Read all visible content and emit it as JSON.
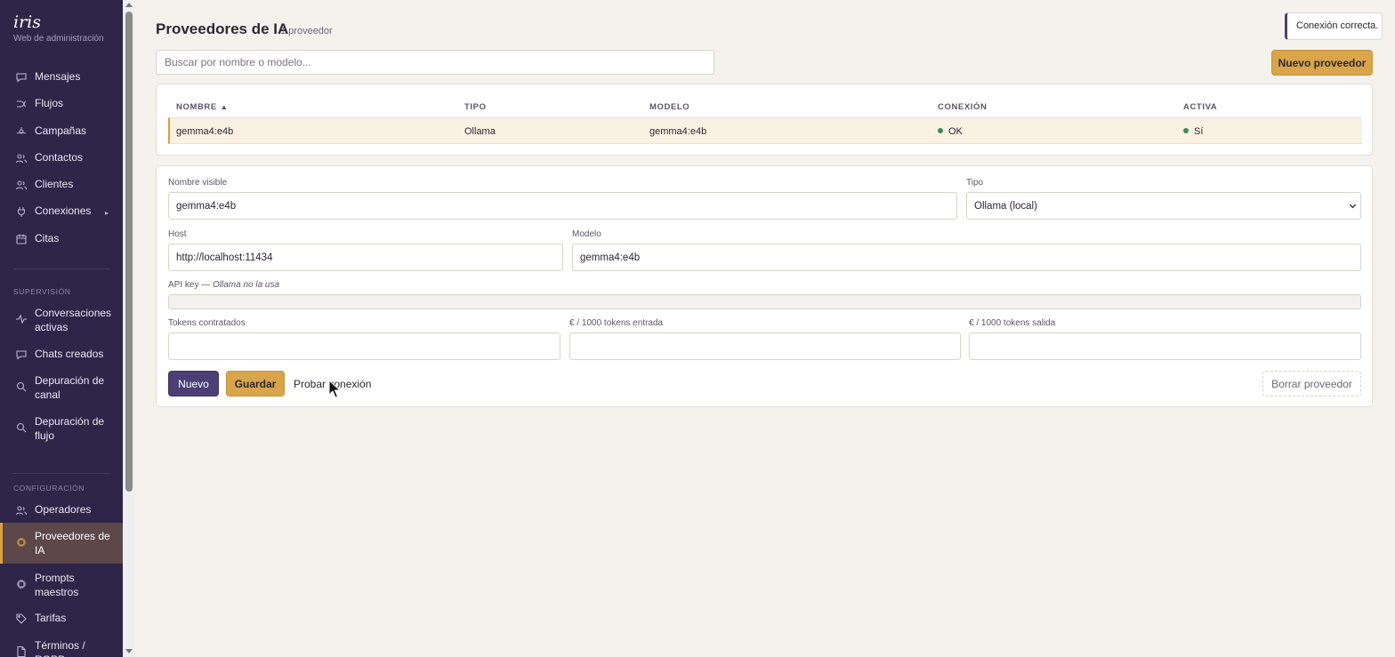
{
  "sidebar": {
    "brand": "iris",
    "subtitle": "Web de administración",
    "items": [
      {
        "label": "Mensajes",
        "icon": "message-icon"
      },
      {
        "label": "Flujos",
        "icon": "flow-icon"
      },
      {
        "label": "Campañas",
        "icon": "campaign-icon"
      },
      {
        "label": "Contactos",
        "icon": "contacts-icon"
      },
      {
        "label": "Clientes",
        "icon": "clients-icon"
      },
      {
        "label": "Conexiones",
        "icon": "plug-icon"
      },
      {
        "label": "Citas",
        "icon": "calendar-icon"
      }
    ],
    "supervision_title": "SUPERVISIÓN",
    "supervision_items": [
      {
        "label": "Conversaciones activas",
        "icon": "activity-icon"
      },
      {
        "label": "Chats creados",
        "icon": "chat-icon"
      },
      {
        "label": "Depuración de canal",
        "icon": "search-icon"
      },
      {
        "label": "Depuración de flujo",
        "icon": "search-icon"
      }
    ],
    "config_title": "CONFIGURACIÓN",
    "config_items": [
      {
        "label": "Operadores",
        "icon": "users-icon"
      },
      {
        "label": "Proveedores de IA",
        "icon": "chip-icon",
        "active": true
      },
      {
        "label": "Prompts maestros",
        "icon": "chip-icon"
      },
      {
        "label": "Tarifas",
        "icon": "tag-icon"
      },
      {
        "label": "Términos / RGPD",
        "icon": "document-icon"
      }
    ]
  },
  "header": {
    "title": "Proveedores de IA",
    "count": "1 proveedor"
  },
  "toast": "Conexión correcta.",
  "search": {
    "placeholder": "Buscar por nombre o modelo...",
    "value": ""
  },
  "new_provider_label": "Nuevo proveedor",
  "table": {
    "columns": [
      "NOMBRE",
      "TIPO",
      "MODELO",
      "CONEXIÓN",
      "ACTIVA"
    ],
    "sort_indicator": "▲",
    "rows": [
      {
        "nombre": "gemma4:e4b",
        "tipo": "Ollama",
        "modelo": "gemma4:e4b",
        "conexion": "OK",
        "activa": "Sí"
      }
    ],
    "status_color": "#3b8a5d"
  },
  "form": {
    "nombre_visible_label": "Nombre visible",
    "nombre_visible_value": "gemma4:e4b",
    "tipo_label": "Tipo",
    "tipo_value": "Ollama (local)",
    "host_label": "Host",
    "host_value": "http://localhost:11434",
    "modelo_label": "Modelo",
    "modelo_value": "gemma4:e4b",
    "api_key_label": "API key — ",
    "api_key_note": "Ollama no la usa",
    "tokens_label": "Tokens contratados",
    "entrada_label": "€ / 1000 tokens entrada",
    "salida_label": "€ / 1000 tokens salida",
    "nuevo_label": "Nuevo",
    "guardar_label": "Guardar",
    "probar_label": "Probar conexión",
    "borrar_label": "Borrar proveedor"
  },
  "colors": {
    "sidebar_bg": "#2e2548",
    "accent": "#d9a54a",
    "primary": "#4c3f75",
    "page_bg": "#f5f2ee"
  }
}
